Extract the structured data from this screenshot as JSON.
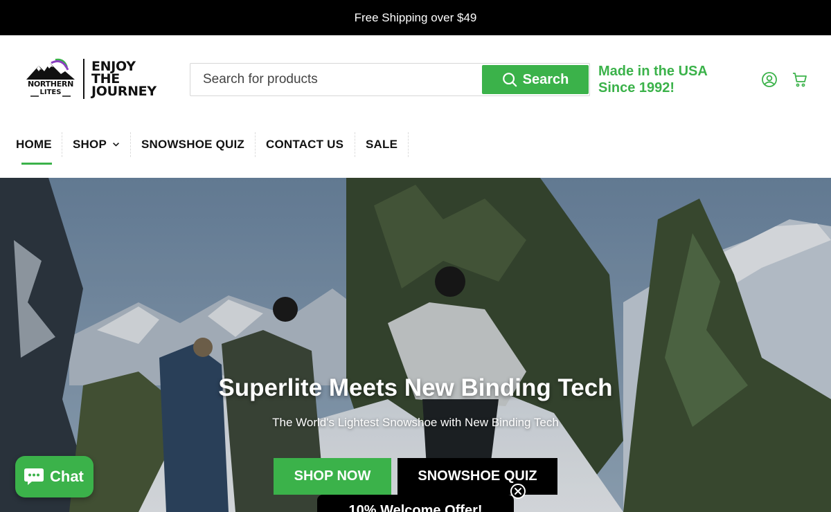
{
  "announcement": {
    "text": "Free Shipping over $49"
  },
  "header": {
    "logo": {
      "brand_line1": "NORTHERN",
      "brand_line2": "LITES",
      "tagline": [
        "ENJOY",
        "THE",
        "JOURNEY"
      ]
    },
    "search": {
      "placeholder": "Search for products",
      "value": "",
      "button_label": "Search"
    },
    "made_in": [
      "Made in the USA",
      "Since 1992!"
    ],
    "icons": [
      "account-icon",
      "cart-icon"
    ]
  },
  "nav": {
    "items": [
      {
        "label": "HOME",
        "active": true
      },
      {
        "label": "SHOP",
        "dropdown": true
      },
      {
        "label": "SNOWSHOE QUIZ"
      },
      {
        "label": "CONTACT US"
      },
      {
        "label": "SALE"
      }
    ]
  },
  "hero": {
    "title": "Superlite Meets New Binding Tech",
    "subtitle": "The World's Lightest Snowshoe with New Binding Tech",
    "primary_cta": "SHOP NOW",
    "secondary_cta": "SNOWSHOE QUIZ"
  },
  "popup": {
    "offer_text": "10% Welcome Offer!"
  },
  "chat": {
    "label": "Chat"
  },
  "colors": {
    "accent": "#3bb24a",
    "announcement_bg": "#000000",
    "text": "#111111"
  }
}
